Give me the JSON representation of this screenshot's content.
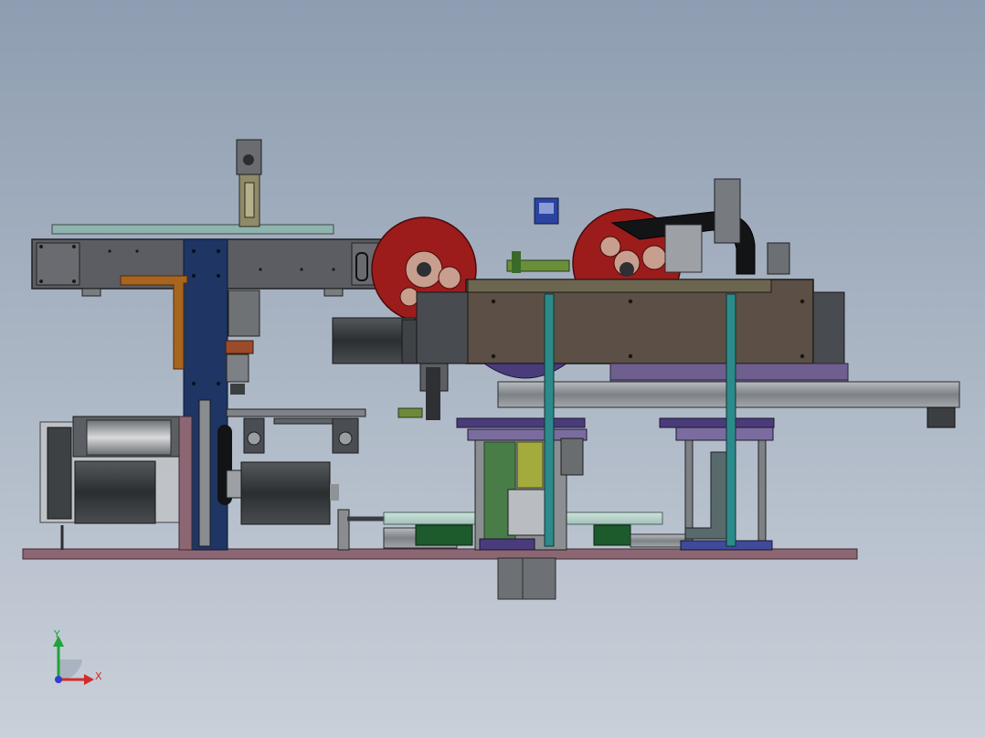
{
  "viewport": {
    "background_top": "#8e9db1",
    "background_bottom": "#c9d0d9"
  },
  "triad": {
    "x_label": "X",
    "y_label": "Y",
    "x_color": "#d22b2b",
    "y_color": "#1fa33a",
    "z_color": "#2b3fd2"
  },
  "colors": {
    "base_plate": "#8d6674",
    "dark_frame": "#5c5d62",
    "blue_column": "#1f3563",
    "reel_red": "#9c1c1c",
    "teal_post": "#2c8a8a",
    "purple_frame": "#6f5f8e",
    "rail_silver": "#9aa0a6",
    "motor_dark": "#2f3234",
    "brown_box": "#5c4f45",
    "orange_bracket": "#a8651f"
  },
  "icons": {
    "triad": "coordinate-triad-icon"
  }
}
